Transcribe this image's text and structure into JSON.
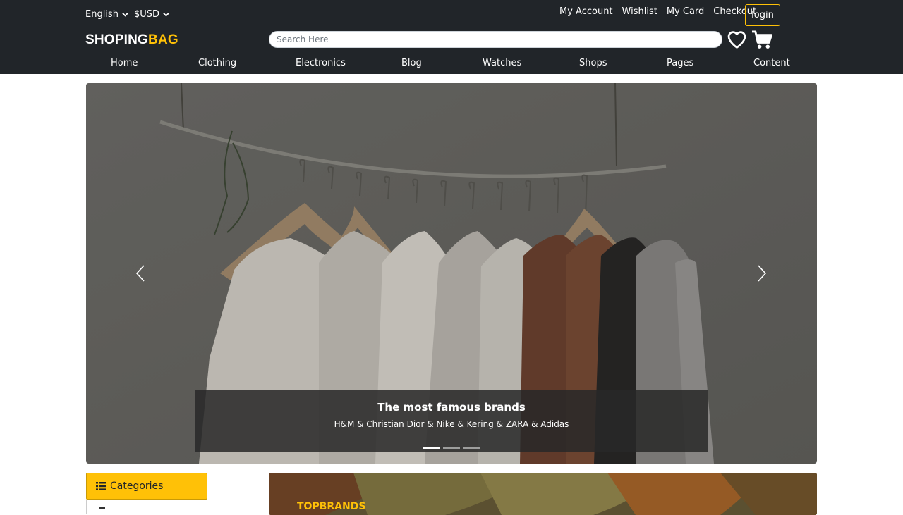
{
  "header": {
    "language": "English",
    "currency": "$USD",
    "links": [
      "My Account",
      "Wishlist",
      "My Card",
      "Checkout"
    ],
    "login": "login",
    "logo_part1": "SHOPING",
    "logo_part2": "BAG",
    "search_placeholder": "Search Here"
  },
  "nav": [
    "Home",
    "Clothing",
    "Electronics",
    "Blog",
    "Watches",
    "Shops",
    "Pages",
    "Content"
  ],
  "carousel": {
    "caption_title": "The most famous brands",
    "caption_text": "H&M & Christian Dior & Nike & Kering & ZARA & Adidas",
    "slides": 3,
    "active_slide": 1
  },
  "categories": {
    "title": "Categories"
  },
  "brands": {
    "title": "TOPBRANDS"
  },
  "colors": {
    "header": "#212529",
    "accent": "#ffc107"
  }
}
